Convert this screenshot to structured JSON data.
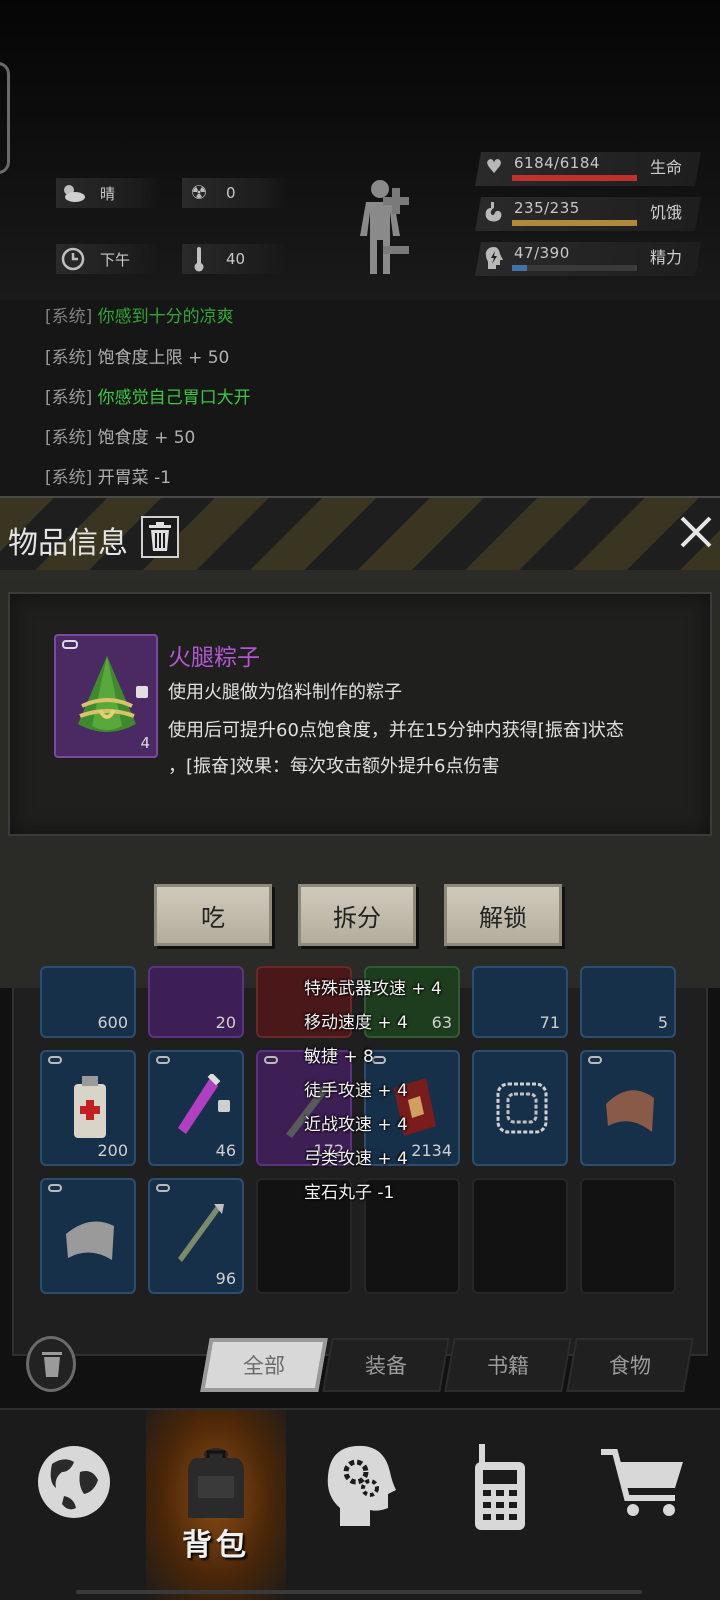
{
  "environment": {
    "weather": "晴",
    "radiation": "0",
    "time_of_day": "下午",
    "temperature": "40",
    "icons": [
      "weather-cloud-sun-icon",
      "radiation-icon",
      "clock-icon",
      "thermometer-icon"
    ]
  },
  "stats": [
    {
      "name": "health",
      "value": "6184/6184",
      "label": "生命",
      "fraction": 1.0,
      "color": "#c0302c"
    },
    {
      "name": "hunger",
      "value": "235/235",
      "label": "饥饿",
      "fraction": 1.0,
      "color": "#b08a3c"
    },
    {
      "name": "energy",
      "value": "47/390",
      "label": "精力",
      "fraction": 0.12,
      "color": "#3f72a8"
    }
  ],
  "log": [
    {
      "tag": "[系统]",
      "msg": "你感到十分的凉爽",
      "green": true
    },
    {
      "tag": "[系统]",
      "msg": "饱食度上限 + 50",
      "green": false
    },
    {
      "tag": "[系统]",
      "msg": "你感觉自己胃口大开",
      "green": true
    },
    {
      "tag": "[系统]",
      "msg": "饱食度 + 50",
      "green": false
    },
    {
      "tag": "[系统]",
      "msg": "开胃菜 -1",
      "green": false
    }
  ],
  "modal": {
    "title": "物品信息",
    "item": {
      "name": "火腿粽子",
      "count": "4",
      "desc1": "使用火腿做为馅料制作的粽子",
      "desc2": "使用后可提升60点饱食度，并在15分钟内获得[振奋]状态",
      "desc3": "，[振奋]效果：每次攻击额外提升6点伤害"
    },
    "buttons": {
      "eat": "吃",
      "split": "拆分",
      "unlock": "解锁"
    }
  },
  "inventory": {
    "row1_counts": [
      "600",
      "20",
      "",
      "63",
      "71",
      "5"
    ],
    "row2_counts": [
      "200",
      "46",
      "172",
      "2134",
      "",
      ""
    ],
    "row3_counts": [
      "",
      "96"
    ]
  },
  "tooltip": [
    "特殊武器攻速 + 4",
    "移动速度 + 4",
    "敏捷 + 8",
    "徒手攻速 + 4",
    "近战攻速 + 4",
    "弓类攻速 + 4",
    "宝石丸子 -1"
  ],
  "tabs": [
    "全部",
    "装备",
    "书籍",
    "食物"
  ],
  "bottom_nav": {
    "backpack": "背包"
  }
}
